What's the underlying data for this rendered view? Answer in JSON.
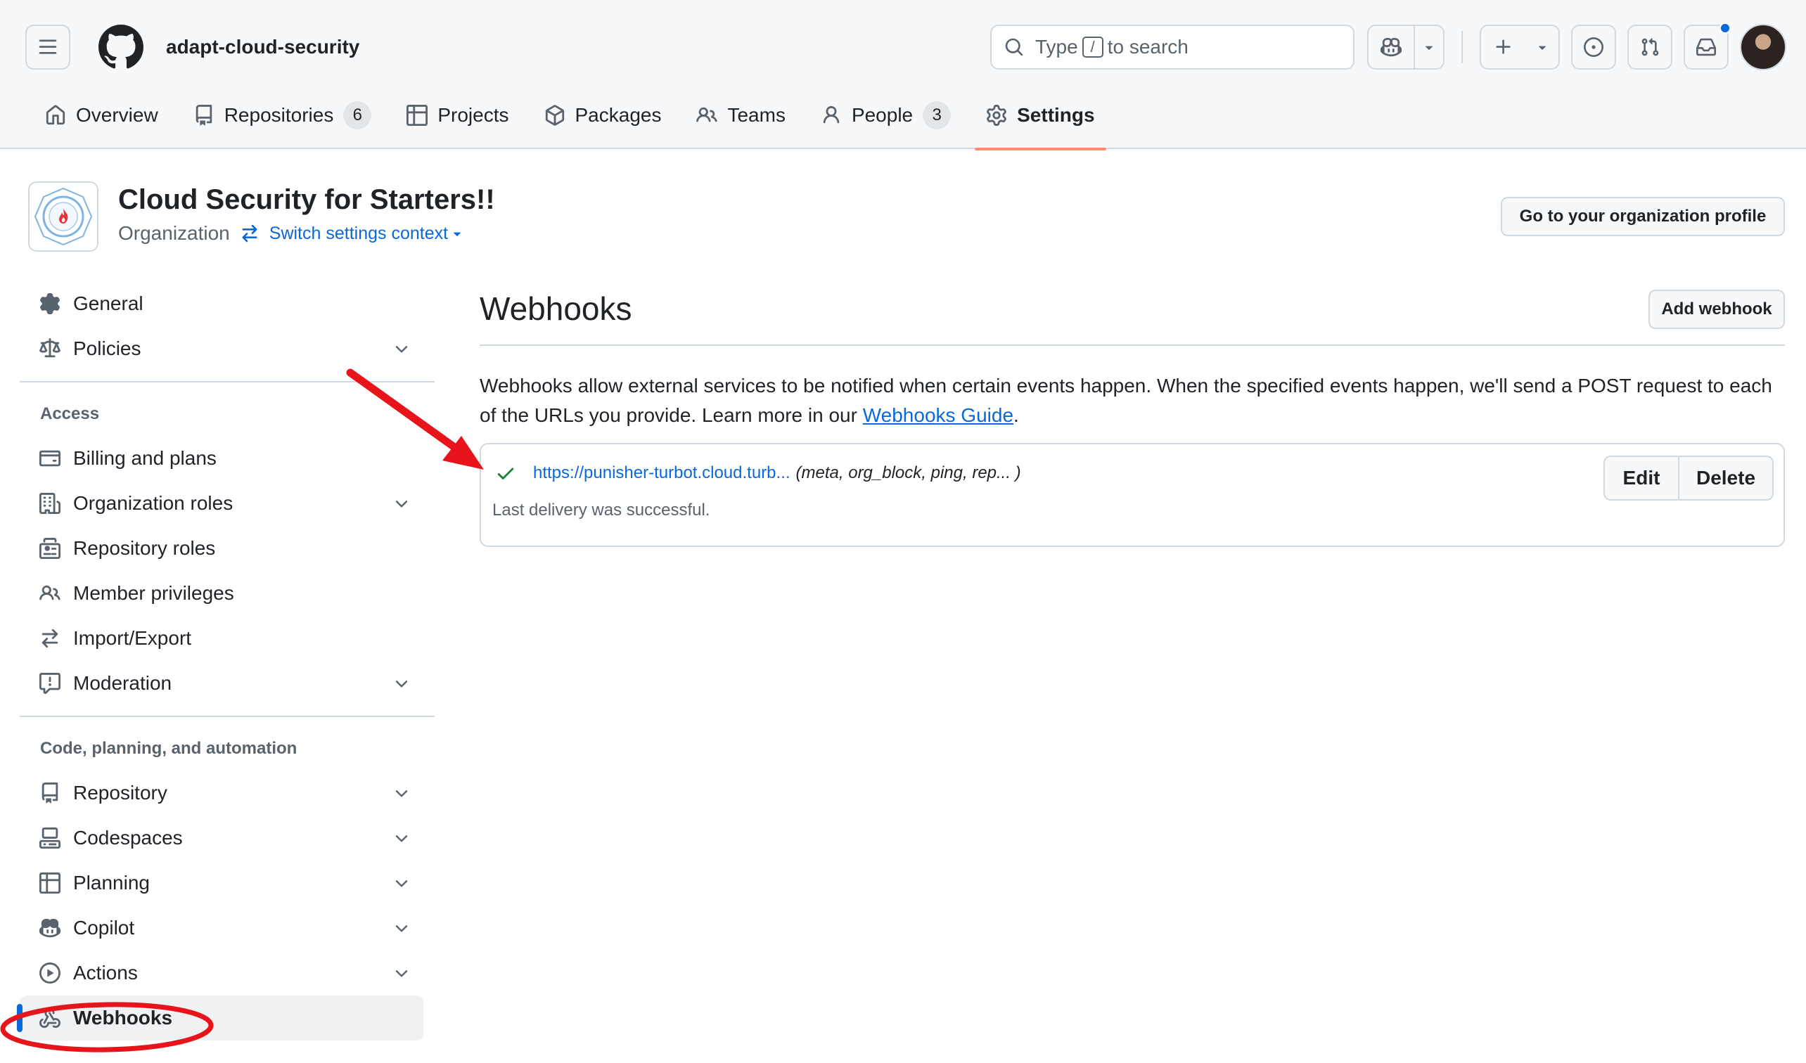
{
  "header": {
    "org_slug": "adapt-cloud-security",
    "search": {
      "prefix": "Type",
      "key": "/",
      "suffix": "to search"
    },
    "icons": [
      "menu-icon",
      "github-logo",
      "search-icon",
      "copilot-icon",
      "plus-icon",
      "issues-icon",
      "pull-requests-icon",
      "inbox-icon"
    ],
    "has_notification": true
  },
  "tabs": [
    {
      "label": "Overview",
      "icon": "home-icon"
    },
    {
      "label": "Repositories",
      "icon": "repo-icon",
      "count": "6"
    },
    {
      "label": "Projects",
      "icon": "table-icon"
    },
    {
      "label": "Packages",
      "icon": "package-icon"
    },
    {
      "label": "Teams",
      "icon": "people-icon"
    },
    {
      "label": "People",
      "icon": "person-icon",
      "count": "3"
    },
    {
      "label": "Settings",
      "icon": "gear-icon",
      "active": true
    }
  ],
  "org": {
    "name": "Cloud Security for Starters!!",
    "type": "Organization",
    "switch_label": "Switch settings context",
    "profile_button": "Go to your organization profile"
  },
  "sidebar": {
    "top": [
      {
        "label": "General",
        "icon": "gear-icon"
      },
      {
        "label": "Policies",
        "icon": "law-icon",
        "expandable": true
      }
    ],
    "access_heading": "Access",
    "access": [
      {
        "label": "Billing and plans",
        "icon": "credit-card-icon"
      },
      {
        "label": "Organization roles",
        "icon": "organization-icon",
        "expandable": true
      },
      {
        "label": "Repository roles",
        "icon": "id-badge-icon"
      },
      {
        "label": "Member privileges",
        "icon": "people-icon"
      },
      {
        "label": "Import/Export",
        "icon": "arrow-switch-icon"
      },
      {
        "label": "Moderation",
        "icon": "report-icon",
        "expandable": true
      }
    ],
    "code_heading": "Code, planning, and automation",
    "code": [
      {
        "label": "Repository",
        "icon": "repo-icon",
        "expandable": true
      },
      {
        "label": "Codespaces",
        "icon": "codespaces-icon",
        "expandable": true
      },
      {
        "label": "Planning",
        "icon": "table-icon",
        "expandable": true
      },
      {
        "label": "Copilot",
        "icon": "copilot-icon",
        "expandable": true
      },
      {
        "label": "Actions",
        "icon": "play-icon",
        "expandable": true
      },
      {
        "label": "Webhooks",
        "icon": "webhook-icon",
        "active": true
      }
    ]
  },
  "main": {
    "title": "Webhooks",
    "add_button": "Add webhook",
    "description_before": "Webhooks allow external services to be notified when certain events happen. When the specified events happen, we'll send a POST request to each of the URLs you provide. Learn more in our ",
    "description_link": "Webhooks Guide",
    "description_after": ".",
    "webhook": {
      "url": "https://punisher-turbot.cloud.turb...",
      "events": "(meta, org_block, ping, rep... )",
      "status": "Last delivery was successful.",
      "edit": "Edit",
      "delete": "Delete"
    }
  },
  "annotations": {
    "color": "#e8141b"
  },
  "colors": {
    "accent": "#0969da",
    "tab_underline": "#fd8c73",
    "success": "#1a7f37",
    "border": "#d1d9e0"
  }
}
